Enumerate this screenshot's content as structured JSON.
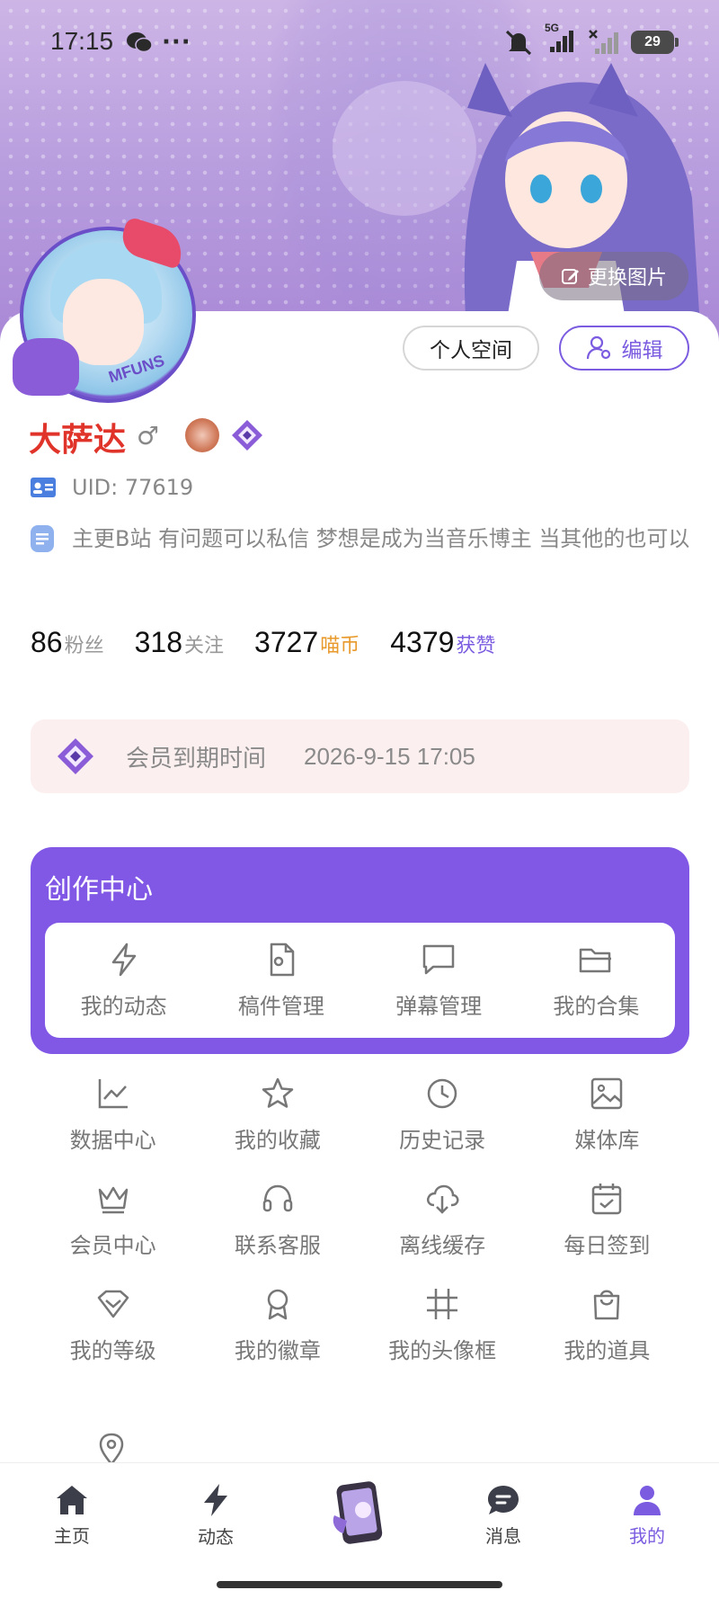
{
  "status_bar": {
    "time": "17:15",
    "battery": "29",
    "network": "5G"
  },
  "banner": {
    "replace_label": "更换图片"
  },
  "profile": {
    "space_button": "个人空间",
    "edit_button": "编辑",
    "name": "大萨达",
    "gender_symbol": "♂",
    "uid": "UID: 77619",
    "bio": "主更B站 有问题可以私信 梦想是成为当音乐博主 当其他的也可以",
    "avatar_text": "MFUNS"
  },
  "stats": [
    {
      "value": "86",
      "label": "粉丝",
      "color": "#999999"
    },
    {
      "value": "318",
      "label": "关注",
      "color": "#999999"
    },
    {
      "value": "3727",
      "label": "喵币",
      "color": "#e89a2c"
    },
    {
      "value": "4379",
      "label": "获赞",
      "color": "#7b5ce0"
    }
  ],
  "vip": {
    "label": "会员到期时间",
    "value": "2026-9-15 17:05"
  },
  "creator_center": {
    "title": "创作中心",
    "items": [
      {
        "label": "我的动态",
        "icon": "bolt-icon"
      },
      {
        "label": "稿件管理",
        "icon": "doc-gear-icon"
      },
      {
        "label": "弹幕管理",
        "icon": "chat-square-icon"
      },
      {
        "label": "我的合集",
        "icon": "folder-icon"
      }
    ]
  },
  "menu": [
    {
      "label": "数据中心",
      "icon": "chart-icon"
    },
    {
      "label": "我的收藏",
      "icon": "star-icon"
    },
    {
      "label": "历史记录",
      "icon": "history-icon"
    },
    {
      "label": "媒体库",
      "icon": "image-icon"
    },
    {
      "label": "会员中心",
      "icon": "crown-icon"
    },
    {
      "label": "联系客服",
      "icon": "headset-icon"
    },
    {
      "label": "离线缓存",
      "icon": "cloud-download-icon"
    },
    {
      "label": "每日签到",
      "icon": "calendar-check-icon"
    },
    {
      "label": "我的等级",
      "icon": "diamond-icon"
    },
    {
      "label": "我的徽章",
      "icon": "medal-icon"
    },
    {
      "label": "我的头像框",
      "icon": "hash-icon"
    },
    {
      "label": "我的道具",
      "icon": "bag-icon"
    }
  ],
  "nav": [
    {
      "label": "主页",
      "icon": "home-icon"
    },
    {
      "label": "动态",
      "icon": "bolt-icon"
    },
    {
      "label": "",
      "icon": "center-phone-icon"
    },
    {
      "label": "消息",
      "icon": "message-icon"
    },
    {
      "label": "我的",
      "icon": "user-icon"
    }
  ],
  "colors": {
    "accent": "#7b5ce0",
    "creator_bg": "#8157e6",
    "username": "#e0342b",
    "vip_bg": "#fcefef"
  }
}
